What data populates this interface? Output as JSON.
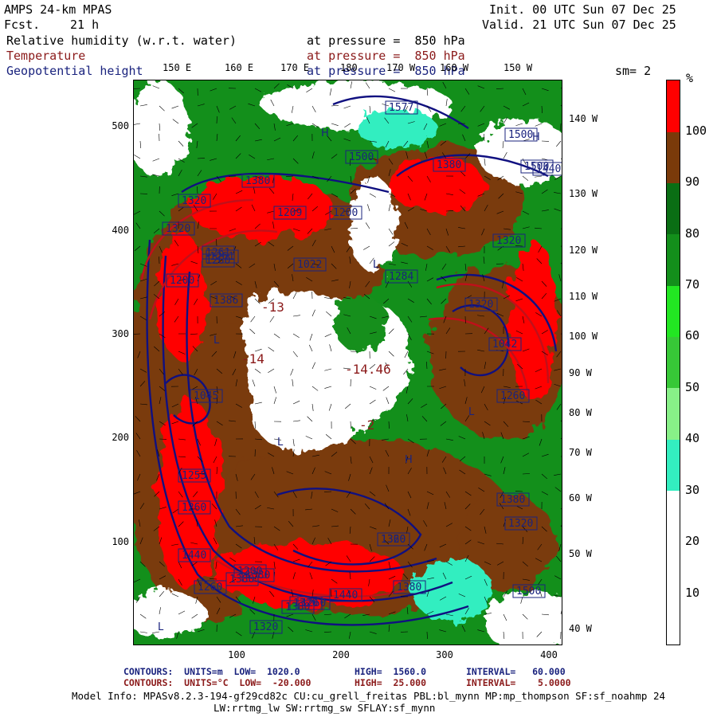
{
  "header": {
    "model": "AMPS 24-km MPAS",
    "fcst_label": "Fcst.",
    "fcst_value": "21 h",
    "init": "Init. 00 UTC Sun 07 Dec 25",
    "valid": "Valid. 21 UTC Sun 07 Dec 25",
    "rh_label": "Relative humidity (w.r.t. water)",
    "rh_level": "at pressure =  850 hPa",
    "temp_label": "Temperature",
    "temp_level": "at pressure =  850 hPa",
    "geo_label": "Geopotential height",
    "geo_level": "at pressure =  850 hPa",
    "sm": "sm= 2"
  },
  "lon_top": [
    "150 E",
    "160 E",
    "170 E",
    "180",
    "170 W",
    "160 W",
    "150 W"
  ],
  "lon_right": [
    "140 W",
    "130 W",
    "120 W",
    "110 W",
    "100 W",
    "90 W",
    "80 W",
    "70 W",
    "60 W",
    "50 W",
    "40 W"
  ],
  "y_ticks": [
    "500",
    "400",
    "300",
    "200",
    "100"
  ],
  "x_ticks": [
    "100",
    "200",
    "300",
    "400"
  ],
  "colorbar": {
    "unit": "%",
    "labels": [
      "100",
      "90",
      "80",
      "70",
      "60",
      "50",
      "40",
      "30",
      "20",
      "10"
    ],
    "colors": {
      "above_100": "#ff0000",
      "90_100": "#7a3a0a",
      "80_90": "#0a6e14",
      "70_80": "#138f1b",
      "60_70": "#22e622",
      "50_60": "#37c837",
      "40_50": "#88f088",
      "30_40": "#33eec0",
      "below_30": "#ffffff"
    }
  },
  "map_labels": {
    "h_labels": [
      "1577",
      "1500",
      "1500",
      "1500",
      "1380",
      "1440",
      "1380",
      "1320",
      "1261",
      "1209",
      "1200",
      "1320",
      "1260",
      "1320",
      "1320",
      "1260",
      "1284",
      "1386",
      "1380",
      "1320",
      "1260",
      "1200",
      "1320",
      "1255",
      "1260",
      "1380",
      "1440",
      "1380",
      "1320",
      "1360",
      "1380",
      "1440",
      "1500",
      "1380",
      "1320",
      "1260",
      "1042",
      "1045",
      "1022",
      "1200",
      "1261"
    ],
    "temp_values": [
      "-13",
      "-14",
      "-14.46",
      "-2"
    ],
    "letters": [
      "H",
      "L",
      "L",
      "L",
      "L",
      "H",
      "H",
      "L"
    ]
  },
  "footer": {
    "contours1_a": "CONTOURS:  UNITS=m  LOW=  1020.0",
    "contours1_b": "HIGH=  1560.0",
    "contours1_c": "INTERVAL=   60.000",
    "contours2_a": "CONTOURS:  UNITS=°C  LOW=  -20.000",
    "contours2_b": "HIGH=  25.000",
    "contours2_c": "INTERVAL=    5.0000",
    "model_info": "Model Info: MPASv8.2.3-194-gf29cd82c CU:cu_grell_freitas PBL:bl_mynn MP:mp_thompson SF:sf_noahmp 24",
    "model_info2": "LW:rrtmg_lw SW:rrtmg_sw SFLAY:sf_mynn"
  }
}
